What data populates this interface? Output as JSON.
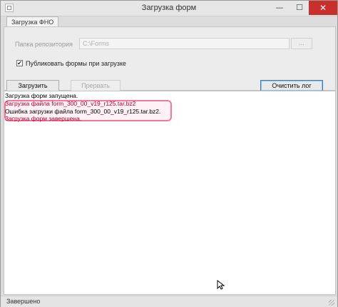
{
  "window": {
    "title": "Загрузка форм",
    "minimize_glyph": "—",
    "maximize_glyph": "☐",
    "close_glyph": "✕",
    "close_color": "#c9302c"
  },
  "tabs": [
    {
      "label": "Загрузка ФНО",
      "selected": true
    }
  ],
  "form": {
    "repo_label": "Папка репозитория",
    "repo_value": "C:\\Forms",
    "browse_label": "...",
    "publish_checked": true,
    "publish_label": "Публиковать формы при загрузке",
    "load_button": "Загрузить",
    "stop_button": "Прервать",
    "clear_button": "Очистить лог"
  },
  "log": {
    "lines": [
      {
        "text": "Загрузка форм запущена.",
        "color": "#000000"
      },
      {
        "text": "Загрузка файла form_300_00_v19_r125.tar.bz2",
        "color": "#b0002a"
      },
      {
        "text": "Ошибка загрузки файла form_300_00_v19_r125.tar.bz2.",
        "color": "#000000"
      },
      {
        "text": "Загрузка форм завершена.",
        "color": "#b0002a"
      }
    ],
    "highlight_color": "#f07b97"
  },
  "status": {
    "text": "Завершено"
  },
  "icons": {
    "app": "app-window-icon",
    "cursor": "mouse-pointer-icon",
    "grip": "resize-grip-icon"
  }
}
